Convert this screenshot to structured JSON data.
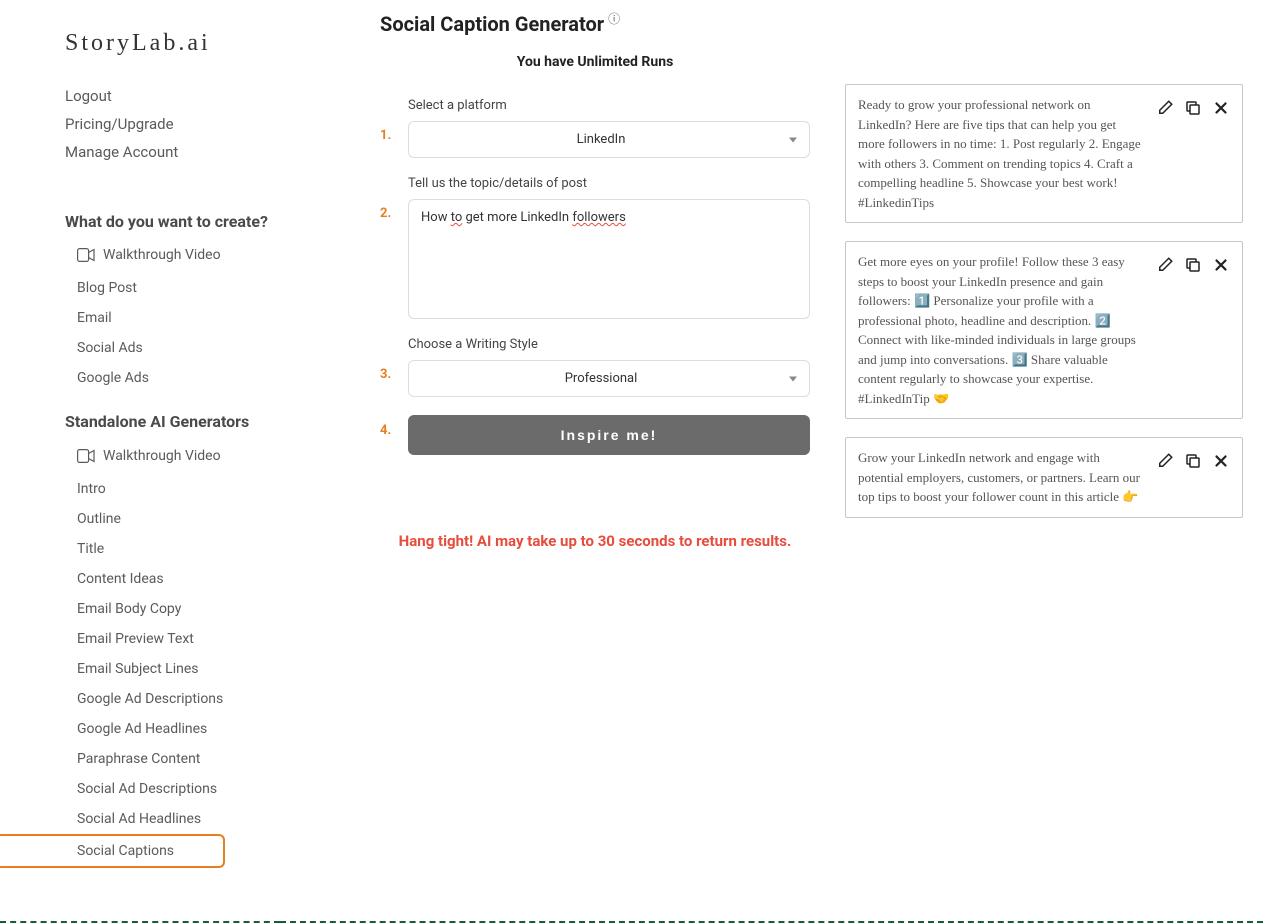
{
  "logo": "StoryLab.ai",
  "account": {
    "logout": "Logout",
    "pricing": "Pricing/Upgrade",
    "manage": "Manage Account"
  },
  "sidebar": {
    "create_title": "What do you want to create?",
    "walkthrough": "Walkthrough Video",
    "create_items": [
      "Blog Post",
      "Email",
      "Social Ads",
      "Google Ads"
    ],
    "standalone_title": "Standalone AI Generators",
    "standalone_items": [
      "Intro",
      "Outline",
      "Title",
      "Content Ideas",
      "Email Body Copy",
      "Email Preview Text",
      "Email Subject Lines",
      "Google Ad Descriptions",
      "Google Ad Headlines",
      "Paraphrase Content",
      "Social Ad Descriptions",
      "Social Ad Headlines",
      "Social Captions"
    ]
  },
  "page": {
    "title": "Social Caption Generator",
    "runs": "You have Unlimited Runs"
  },
  "form": {
    "step1_label": "Select a platform",
    "step1_value": "LinkedIn",
    "step2_label": "Tell us the topic/details of post",
    "step2_value": "How to get more LinkedIn followers",
    "step3_label": "Choose a Writing Style",
    "step3_value": "Professional",
    "inspire": "Inspire me!",
    "wait": "Hang tight! AI may take up to 30 seconds to return results."
  },
  "results": [
    "Ready to grow your professional network on LinkedIn? Here are five tips that can help you get more followers in no time: 1. Post regularly 2. Engage with others 3. Comment on trending topics 4. Craft a compelling headline 5. Showcase your best work! #LinkedinTips",
    "Get more eyes on your profile! Follow these 3 easy steps to boost your LinkedIn presence and gain followers: 1️⃣ Personalize your profile with a professional photo, headline and description. 2️⃣ Connect with like-minded individuals in large groups and jump into conversations. 3️⃣ Share valuable content regularly to showcase your expertise. #LinkedInTip 🤝",
    "Grow your LinkedIn network and engage with potential employers, customers, or partners. Learn our top tips to boost your follower count in this article 👉"
  ]
}
